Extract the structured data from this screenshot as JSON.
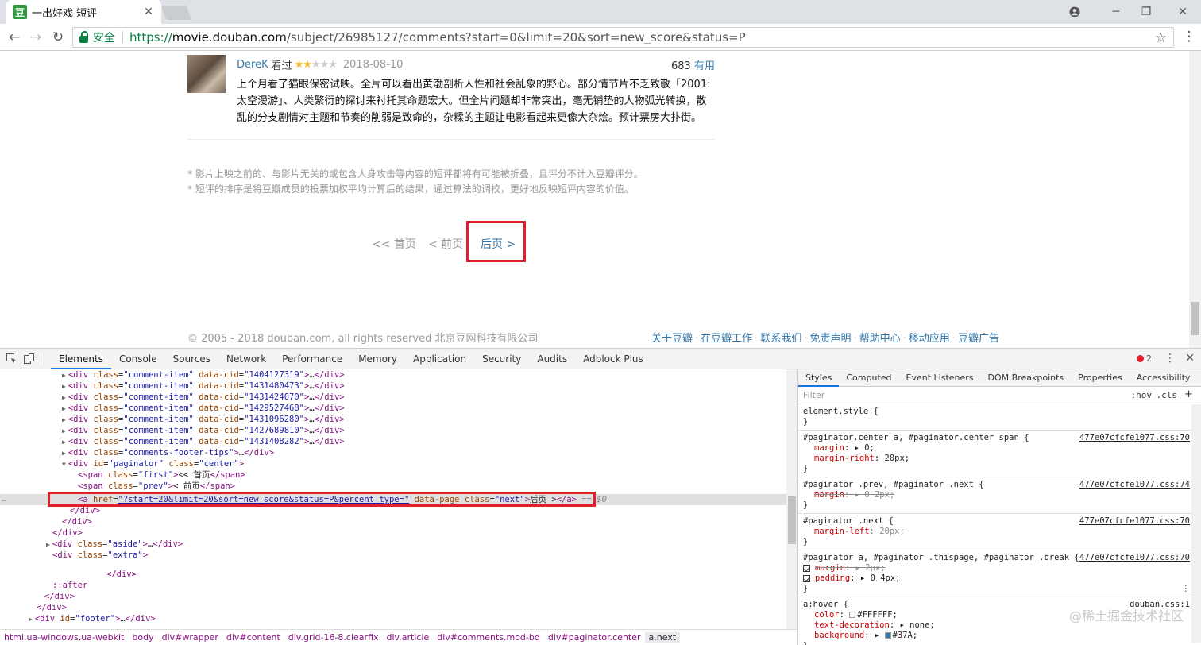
{
  "browser": {
    "tab_title": "一出好戏 短评",
    "favicon_text": "豆",
    "secure_label": "安全",
    "url_scheme": "https://",
    "url_host": "movie.douban.com",
    "url_path": "/subject/26985127/comments?start=0&limit=20&sort=new_score&status=P"
  },
  "comment": {
    "user": "DereK",
    "action": "看过",
    "stars_filled": "★★",
    "stars_empty": "★★★",
    "rating": 2,
    "date": "2018-08-10",
    "votes": "683",
    "useful_label": "有用",
    "text": "上个月看了猫眼保密试映。全片可以看出黄渤剖析人性和社会乱象的野心。部分情节片不乏致敬「2001:太空漫游」、人类繁衍的探讨来衬托其命题宏大。但全片问题却非常突出，毫无铺垫的人物弧光转换，散乱的分支剧情对主题和节奏的削弱是致命的，杂糅的主题让电影看起来更像大杂烩。预计票房大扑街。"
  },
  "tips": [
    "* 影片上映之前的、与影片无关的或包含人身攻击等内容的短评都将有可能被折叠，且评分不计入豆瓣评分。",
    "* 短评的排序是将豆瓣成员的投票加权平均计算后的结果，通过算法的调校，更好地反映短评内容的价值。"
  ],
  "paginator": {
    "first": "<< 首页",
    "prev": "< 前页",
    "next": "后页 >"
  },
  "footer": {
    "copyright": "© 2005 - 2018 douban.com, all rights reserved 北京豆网科技有限公司",
    "links": [
      "关于豆瓣",
      "在豆瓣工作",
      "联系我们",
      "免责声明",
      "帮助中心",
      "移动应用",
      "豆瓣广告"
    ]
  },
  "devtools": {
    "tabs": [
      "Elements",
      "Console",
      "Sources",
      "Network",
      "Performance",
      "Memory",
      "Application",
      "Security",
      "Audits",
      "Adblock Plus"
    ],
    "active_tab": "Elements",
    "error_count": "2",
    "comment_items": [
      "1404127319",
      "1431480473",
      "1431424070",
      "1429527468",
      "1431096280",
      "1427689810",
      "1431408282"
    ],
    "footer_tips_class": "comments-footer-tips",
    "paginator_id": "paginator",
    "paginator_class": "center",
    "span_first_class": "first",
    "span_first_text": "<< 首页",
    "span_prev_class": "prev",
    "span_prev_text": "< 前页",
    "a_href": "?start=20&limit=20&sort=new_score&status=P&percent_type=",
    "a_data_attr": "data-page",
    "a_class": "next",
    "a_text": "后页 >",
    "selected_marker": "== $0",
    "aside_class": "aside",
    "extra_class": "extra",
    "after_pseudo": "::after",
    "footer_id": "footer",
    "breadcrumbs": [
      "html.ua-windows.ua-webkit",
      "body",
      "div#wrapper",
      "div#content",
      "div.grid-16-8.clearfix",
      "div.article",
      "div#comments.mod-bd",
      "div#paginator.center",
      "a.next"
    ],
    "styles_tabs": [
      "Styles",
      "Computed",
      "Event Listeners",
      "DOM Breakpoints",
      "Properties",
      "Accessibility"
    ],
    "filter_placeholder": "Filter",
    "hov_label": ":hov",
    "cls_label": ".cls",
    "rules": {
      "element_style": "element.style {",
      "r1_selector": "#paginator.center a, #paginator.center span {",
      "r1_source": "477e07cfcfe1077.css:70",
      "r1_p1_name": "margin",
      "r1_p1_value": "0;",
      "r1_p2_name": "margin-right",
      "r1_p2_value": "20px;",
      "r2_selector": "#paginator .prev, #paginator .next {",
      "r2_source": "477e07cfcfe1077.css:74",
      "r2_p1_name": "margin",
      "r2_p1_value": "0 2px;",
      "r3_selector": "#paginator .next {",
      "r3_source": "477e07cfcfe1077.css:70",
      "r3_p1_name": "margin-left",
      "r3_p1_value": "20px;",
      "r4_selector": "#paginator a, #paginator .thispage, #paginator .break {",
      "r4_source": "477e07cfcfe1077.css:70",
      "r4_p1_name": "margin",
      "r4_p1_value": "2px;",
      "r4_p2_name": "padding",
      "r4_p2_value": "0 4px;",
      "r5_selector": "a:hover {",
      "r5_source": "douban.css:1",
      "r5_p1_name": "color",
      "r5_p1_value": "#FFFFFF;",
      "r5_p2_name": "text-decoration",
      "r5_p2_value": "none;",
      "r5_p3_name": "background",
      "r5_p3_value": "#37A;",
      "close_brace": "}"
    }
  },
  "watermark": "@稀土掘金技术社区",
  "colors": {
    "link": "#3377aa",
    "highlight_border": "#e0202a",
    "secure_green": "#0b8043",
    "star": "#f5b826"
  }
}
